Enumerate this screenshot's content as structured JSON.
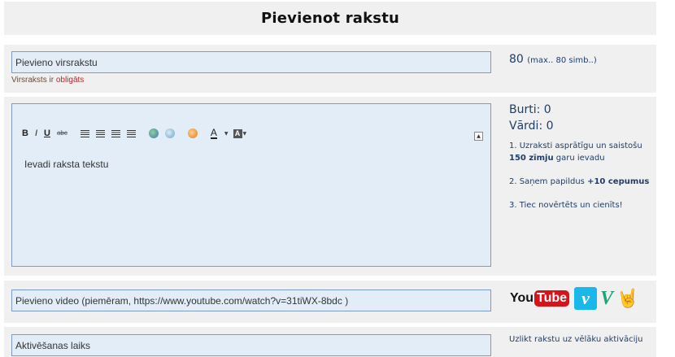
{
  "header": {
    "title": "Pievienot rakstu"
  },
  "title_field": {
    "value": "Pievieno virsrakstu",
    "hint_prefix": "Virsraksts ir",
    "hint_required": "obligāts",
    "counter_value": "80",
    "counter_note": "(max.. 80 simb..)"
  },
  "editor": {
    "toolbar": {
      "bold": "B",
      "italic": "I",
      "underline": "U",
      "strike": "abc",
      "font_color": "A",
      "font_bg": "A"
    },
    "placeholder_text": "Ievadi raksta tekstu",
    "stats": {
      "letters": "Burti: 0",
      "words": "Vārdi: 0"
    },
    "tips": {
      "tip1_pre": "1. Uzraksti asprātīgu un saistošu",
      "tip1_bold": "150 zīmju",
      "tip1_post": "garu ievadu",
      "tip2_pre": "2. Saņem papildus",
      "tip2_bold": "+10 cepumus",
      "tip3": "3. Tiec novērtēts un cienīts!"
    }
  },
  "video_field": {
    "value": "Pievieno video (piemēram, https://www.youtube.com/watch?v=31tiWX-8bdc )",
    "logos": {
      "youtube_you": "You",
      "youtube_tube": "Tube",
      "vimeo": "v",
      "vine": "V"
    }
  },
  "activation_field": {
    "value": "Aktivēšanas laiks",
    "note": "Uzlikt rakstu uz vēlāku aktivāciju"
  },
  "colors": {
    "field_bg": "#e3edf8",
    "field_border": "#7a9cc6",
    "section_bg": "#f0f0f0",
    "accent_text": "#1f3d66",
    "required": "#b3282d"
  }
}
